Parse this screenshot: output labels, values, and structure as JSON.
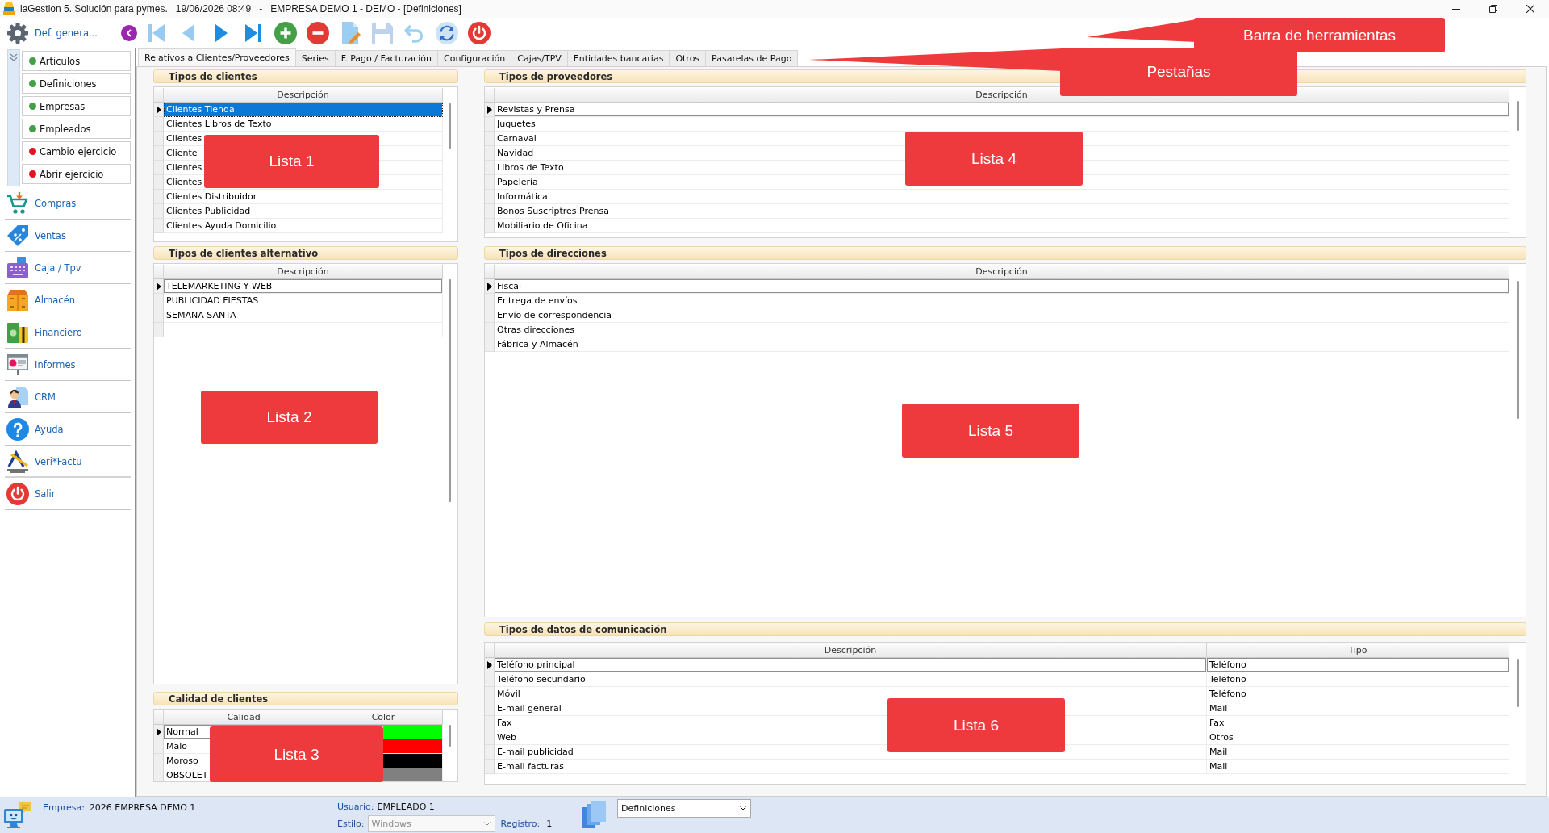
{
  "window": {
    "title": "iaGestion 5. Solución para pymes.   19/06/2026 08:49   -   EMPRESA DEMO 1 - DEMO - [Definiciones]"
  },
  "sidebar": {
    "title": "Def. genera...",
    "shortcuts": [
      {
        "label": "Articulos",
        "color": "#43a047"
      },
      {
        "label": "Definiciones",
        "color": "#43a047"
      },
      {
        "label": "Empresas",
        "color": "#43a047"
      },
      {
        "label": "Empleados",
        "color": "#43a047"
      },
      {
        "label": "Cambio ejercicio",
        "color": "#e81123"
      },
      {
        "label": "Abrir ejercicio",
        "color": "#e81123"
      }
    ],
    "menu": [
      "Compras",
      "Ventas",
      "Caja / Tpv",
      "Almacén",
      "Financiero",
      "Informes",
      "CRM",
      "Ayuda",
      "Veri*Factu",
      "Salir"
    ]
  },
  "toolbar": [
    {
      "kind": "first",
      "disabled": true
    },
    {
      "kind": "previous",
      "disabled": true
    },
    {
      "kind": "next",
      "disabled": false
    },
    {
      "kind": "last",
      "disabled": false
    },
    {
      "kind": "add",
      "disabled": false
    },
    {
      "kind": "delete",
      "disabled": false
    },
    {
      "kind": "edit",
      "disabled": false
    },
    {
      "kind": "save",
      "disabled": true
    },
    {
      "kind": "undo",
      "disabled": true
    },
    {
      "kind": "refresh",
      "disabled": false
    },
    {
      "kind": "exit",
      "disabled": false
    }
  ],
  "tabs": [
    {
      "label": "Relativos a Clientes/Proveedores",
      "selected": true
    },
    {
      "label": "Series",
      "selected": false
    },
    {
      "label": "F. Pago / Facturación",
      "selected": false
    },
    {
      "label": "Configuración",
      "selected": false
    },
    {
      "label": "Cajas/TPV",
      "selected": false
    },
    {
      "label": "Entidades bancarias",
      "selected": false
    },
    {
      "label": "Otros",
      "selected": false
    },
    {
      "label": "Pasarelas de Pago",
      "selected": false
    }
  ],
  "left_lists": [
    {
      "title": "Tipos de clientes",
      "focused": true,
      "columns": [
        "Descripción"
      ],
      "rows": [
        {
          "cells": [
            "Clientes Tienda"
          ],
          "selected": true
        },
        {
          "cells": [
            "Clientes Libros de Texto"
          ],
          "selected": false
        },
        {
          "cells": [
            "Clientes"
          ],
          "selected": false
        },
        {
          "cells": [
            "Cliente"
          ],
          "selected": false
        },
        {
          "cells": [
            "Clientes"
          ],
          "selected": false
        },
        {
          "cells": [
            "Clientes"
          ],
          "selected": false
        },
        {
          "cells": [
            "Clientes Distribuidor"
          ],
          "selected": false
        },
        {
          "cells": [
            "Clientes Publicidad"
          ],
          "selected": false
        },
        {
          "cells": [
            "Clientes Ayuda Domicilio"
          ],
          "selected": false
        }
      ]
    },
    {
      "title": "Tipos de clientes alternativo",
      "focused": false,
      "new_row": true,
      "columns": [
        "Descripción"
      ],
      "rows": [
        {
          "cells": [
            "TELEMARKETING Y WEB"
          ],
          "selected": true
        },
        {
          "cells": [
            "PUBLICIDAD FIESTAS"
          ],
          "selected": false
        },
        {
          "cells": [
            "SEMANA SANTA"
          ],
          "selected": false
        }
      ]
    },
    {
      "title": "Calidad de clientes",
      "focused": false,
      "columns": [
        "Calidad",
        "Color"
      ],
      "rows": [
        {
          "cells": [
            "Normal"
          ],
          "color": "#00ff00",
          "selected": true
        },
        {
          "cells": [
            "Malo"
          ],
          "color": "#ff0000",
          "selected": false
        },
        {
          "cells": [
            "Moroso"
          ],
          "color": "#000000",
          "selected": false
        },
        {
          "cells": [
            "OBSOLET"
          ],
          "color": "#808080",
          "selected": false
        }
      ]
    }
  ],
  "right_lists": [
    {
      "title": "Tipos de proveedores",
      "focused": false,
      "columns": [
        "Descripción"
      ],
      "rows": [
        {
          "cells": [
            "Revistas y Prensa"
          ],
          "selected": true
        },
        {
          "cells": [
            "Juguetes"
          ],
          "selected": false
        },
        {
          "cells": [
            "Carnaval"
          ],
          "selected": false
        },
        {
          "cells": [
            "Navidad"
          ],
          "selected": false
        },
        {
          "cells": [
            "Libros de Texto"
          ],
          "selected": false
        },
        {
          "cells": [
            "Papelería"
          ],
          "selected": false
        },
        {
          "cells": [
            "Informática"
          ],
          "selected": false
        },
        {
          "cells": [
            "Bonos Suscriptres Prensa"
          ],
          "selected": false
        },
        {
          "cells": [
            "Mobiliario de Oficina"
          ],
          "selected": false
        }
      ]
    },
    {
      "title": "Tipos de direcciones",
      "focused": false,
      "columns": [
        "Descripción"
      ],
      "rows": [
        {
          "cells": [
            "Fiscal"
          ],
          "selected": true
        },
        {
          "cells": [
            "Entrega de envíos"
          ],
          "selected": false
        },
        {
          "cells": [
            "Envío de correspondencia"
          ],
          "selected": false
        },
        {
          "cells": [
            "Otras direcciones"
          ],
          "selected": false
        },
        {
          "cells": [
            "Fábrica y Almacén"
          ],
          "selected": false
        }
      ]
    },
    {
      "title": "Tipos de datos de comunicación",
      "focused": false,
      "columns": [
        "Descripción",
        "Tipo"
      ],
      "rows": [
        {
          "cells": [
            "Teléfono principal",
            "Teléfono"
          ],
          "selected": true
        },
        {
          "cells": [
            "Teléfono secundario",
            "Teléfono"
          ],
          "selected": false
        },
        {
          "cells": [
            "Móvil",
            "Teléfono"
          ],
          "selected": false
        },
        {
          "cells": [
            "E-mail general",
            "Mail"
          ],
          "selected": false
        },
        {
          "cells": [
            "Fax",
            "Fax"
          ],
          "selected": false
        },
        {
          "cells": [
            "Web",
            "Otros"
          ],
          "selected": false
        },
        {
          "cells": [
            "E-mail publicidad",
            "Mail"
          ],
          "selected": false
        },
        {
          "cells": [
            "E-mail facturas",
            "Mail"
          ],
          "selected": false
        }
      ]
    }
  ],
  "status_bar": {
    "company_label": "Empresa:",
    "company": "2026 EMPRESA DEMO 1",
    "user_label": "Usuario:",
    "user": "EMPLEADO 1",
    "style_label": "Estilo:",
    "style": {
      "value": "Windows",
      "disabled": true
    },
    "record_label": "Registro:",
    "record": "1",
    "view": {
      "value": "Definiciones"
    }
  },
  "callouts": [
    {
      "text": "Barra de herramientas",
      "pointer": true
    },
    {
      "text": "Pestañas",
      "pointer": true
    },
    {
      "text": "Lista 1",
      "pointer": false
    },
    {
      "text": "Lista 2",
      "pointer": false
    },
    {
      "text": "Lista 3",
      "pointer": false
    },
    {
      "text": "Lista 4",
      "pointer": false
    },
    {
      "text": "Lista 5",
      "pointer": false
    },
    {
      "text": "Lista 6",
      "pointer": false
    }
  ]
}
